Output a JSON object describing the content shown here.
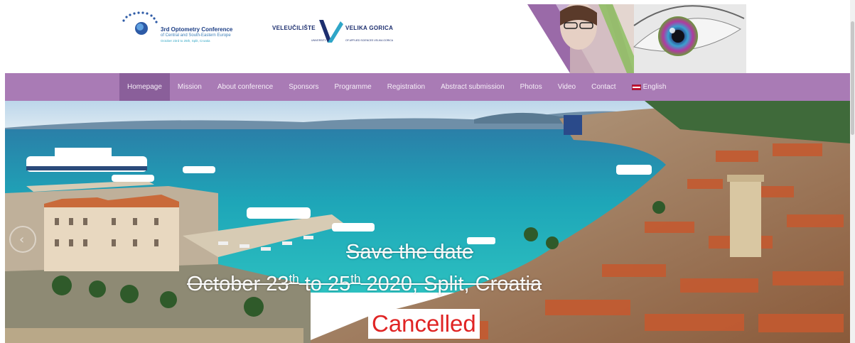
{
  "header": {
    "conference_logo": {
      "line1": "3rd Optometry Conference",
      "line2": "of Central and South-Eastern Europe",
      "line3": "October 23rd to 25th, Split, Croatia"
    },
    "school_logo": {
      "left_word": "VELEUČILIŠTE",
      "right_word": "VELIKA GORICA",
      "sub_left": "UNIVERSITY",
      "sub_right": "OF APPLIED SCIENCES VELIKA GORICA"
    }
  },
  "nav": {
    "items": [
      {
        "label": "Homepage",
        "active": true
      },
      {
        "label": "Mission"
      },
      {
        "label": "About conference"
      },
      {
        "label": "Sponsors"
      },
      {
        "label": "Programme"
      },
      {
        "label": "Registration"
      },
      {
        "label": "Abstract submission"
      },
      {
        "label": "Photos"
      },
      {
        "label": "Video"
      },
      {
        "label": "Contact"
      },
      {
        "label": "English",
        "icon": "croatia-flag-icon"
      }
    ]
  },
  "hero": {
    "save_the_date": "Save the date",
    "dates": {
      "start_day": "October 23",
      "start_sup": "th",
      "connector": " to 25",
      "end_sup": "th",
      "rest": " 2020, Split, Croatia"
    },
    "status": "Cancelled",
    "prev_icon": "chevron-left-icon"
  },
  "colors": {
    "nav_bg": "#a97bb5",
    "nav_active": "#8a5f9a",
    "status_red": "#e02424"
  }
}
